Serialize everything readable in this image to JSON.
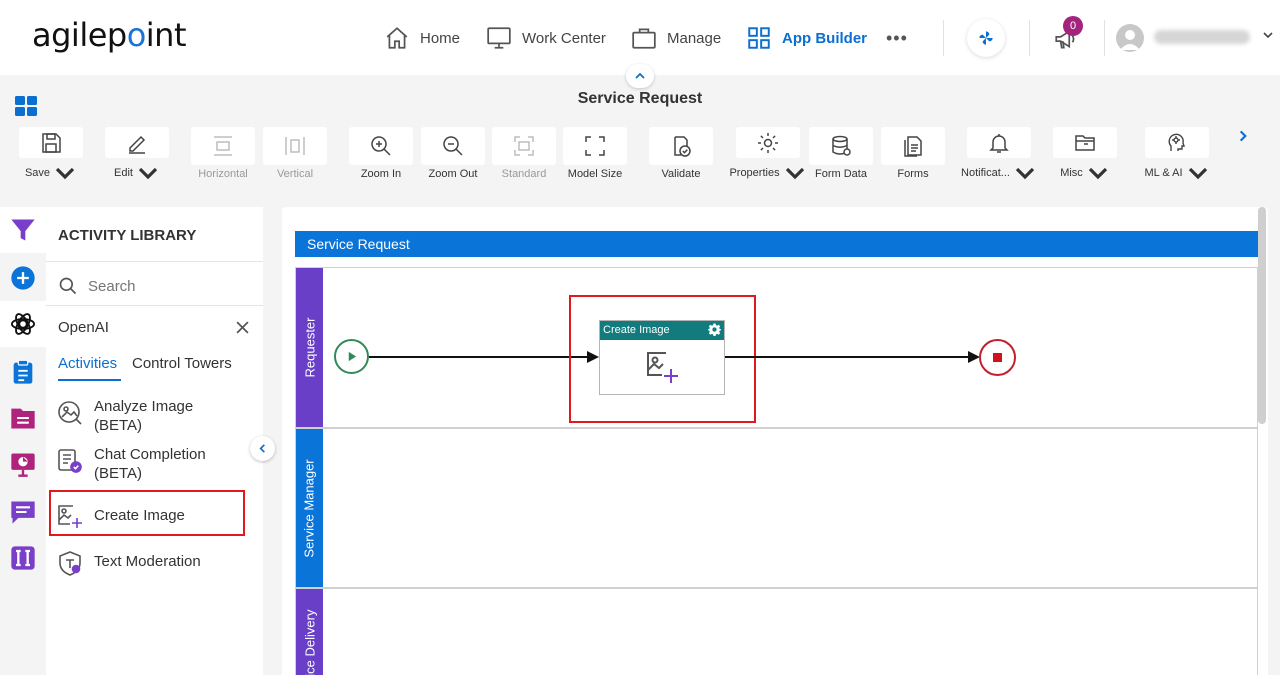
{
  "brand": {
    "logo_text_1": "agilep",
    "logo_text_2": "int"
  },
  "nav": {
    "home": "Home",
    "work_center": "Work Center",
    "manage": "Manage",
    "app_builder": "App Builder",
    "more": "•••",
    "notifications_count": "0"
  },
  "page": {
    "title": "Service Request"
  },
  "toolbar": {
    "save": "Save",
    "edit": "Edit",
    "horizontal": "Horizontal",
    "vertical": "Vertical",
    "zoom_in": "Zoom In",
    "zoom_out": "Zoom Out",
    "standard": "Standard",
    "model_size": "Model Size",
    "validate": "Validate",
    "properties": "Properties",
    "form_data": "Form Data",
    "forms": "Forms",
    "notifications": "Notificat...",
    "misc": "Misc",
    "ml_ai": "ML & AI"
  },
  "library": {
    "title": "ACTIVITY LIBRARY",
    "search_placeholder": "Search",
    "category": "OpenAI",
    "tabs": {
      "activities": "Activities",
      "control_towers": "Control Towers"
    },
    "items": [
      {
        "label": "Analyze Image (BETA)"
      },
      {
        "label": "Chat Completion (BETA)"
      },
      {
        "label": "Create Image"
      },
      {
        "label": "Text Moderation"
      }
    ]
  },
  "canvas": {
    "pool_name": "Service Request",
    "lanes": [
      {
        "label": "Requester",
        "color": "#6a3fc8"
      },
      {
        "label": "Service Manager",
        "color": "#0b74d8"
      },
      {
        "label": "Service Delivery",
        "color": "#6a3fc8"
      }
    ],
    "activity": {
      "title": "Create Image"
    }
  },
  "colors": {
    "accent": "#0b6fd1",
    "highlight": "#e0191f",
    "activity_header": "#117b7e"
  }
}
